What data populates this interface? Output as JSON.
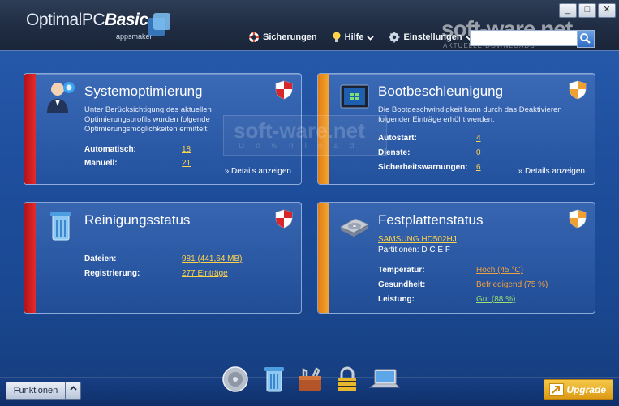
{
  "window": {
    "logo_main": "OptimalPC",
    "logo_bold": "Basic",
    "logo_sub": "appsmaker",
    "controls": [
      "_",
      "□",
      "✕"
    ]
  },
  "nav": {
    "backups": "Sicherungen",
    "help": "Hilfe",
    "settings": "Einstellungen"
  },
  "watermark": {
    "top": "soft-ware.net",
    "top_sub": "AKTUELLE DOWNLOADS",
    "mid": "soft-ware.net",
    "mid_sub": "Download"
  },
  "panels": {
    "system": {
      "title": "Systemoptimierung",
      "desc": "Unter Berücksichtigung des aktuellen Optimierungsprofils wurden folgende Optimierungsmöglichkeiten ermittelt:",
      "automatic_label": "Automatisch:",
      "automatic_value": "18",
      "manual_label": "Manuell:",
      "manual_value": "21",
      "details": "» Details anzeigen"
    },
    "boot": {
      "title": "Bootbeschleunigung",
      "desc": "Die Bootgeschwindigkeit kann durch das Deaktivieren folgender Einträge erhöht werden:",
      "autostart_label": "Autostart:",
      "autostart_value": "4",
      "services_label": "Dienste:",
      "services_value": "0",
      "warnings_label": "Sicherheitswarnungen:",
      "warnings_value": "6",
      "details": "» Details anzeigen"
    },
    "cleaning": {
      "title": "Reinigungsstatus",
      "files_label": "Dateien:",
      "files_value": "981 (441,64 MB)",
      "registry_label": "Registrierung:",
      "registry_value": "277 Einträge"
    },
    "disk": {
      "title": "Festplattenstatus",
      "drive": "SAMSUNG HD502HJ",
      "partitions": "Partitionen: D C E F",
      "temp_label": "Temperatur:",
      "temp_value": "Hoch (45 °C)",
      "health_label": "Gesundheit:",
      "health_value": "Befriedigend (75 %)",
      "perf_label": "Leistung:",
      "perf_value": "Gut (88 %)"
    }
  },
  "bottom": {
    "functions": "Funktionen",
    "upgrade": "Upgrade"
  },
  "colors": {
    "accent_red": "#e52a2a",
    "accent_orange": "#f6a83a",
    "link_yellow": "#ffd34a",
    "link_orange": "#f0a040",
    "link_green": "#9be070"
  }
}
